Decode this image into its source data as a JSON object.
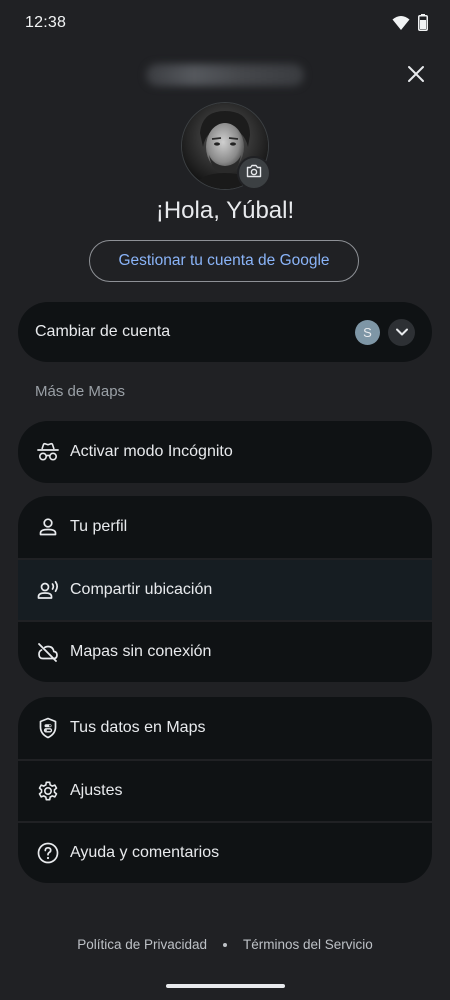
{
  "status_bar": {
    "time": "12:38",
    "icons": [
      "wifi-icon",
      "battery-icon"
    ]
  },
  "header": {
    "close_icon": "close-icon",
    "greeting": "¡Hola, Yúbal!",
    "manage_account_label": "Gestionar tu cuenta de Google",
    "camera_icon": "camera-icon"
  },
  "switch_account": {
    "label": "Cambiar de cuenta",
    "other_account_initial": "S",
    "expand_icon": "chevron-down-icon"
  },
  "more_section_label": "Más de Maps",
  "incognito": {
    "label": "Activar modo Incógnito",
    "icon": "incognito-icon"
  },
  "profile_group": [
    {
      "label": "Tu perfil",
      "icon": "person-icon"
    },
    {
      "label": "Compartir ubicación",
      "icon": "location-sharing-icon"
    },
    {
      "label": "Mapas sin conexión",
      "icon": "cloud-off-icon"
    }
  ],
  "settings_group": [
    {
      "label": "Tus datos en Maps",
      "icon": "shield-icon"
    },
    {
      "label": "Ajustes",
      "icon": "gear-icon"
    },
    {
      "label": "Ayuda y comentarios",
      "icon": "help-icon"
    }
  ],
  "footer": {
    "privacy_label": "Política de Privacidad",
    "terms_label": "Términos del Servicio"
  },
  "colors": {
    "background": "#202124",
    "card": "#0f1214",
    "link_blue": "#8ab4f8",
    "text": "#e8eaed",
    "secondary_text": "#9aa0a6"
  }
}
